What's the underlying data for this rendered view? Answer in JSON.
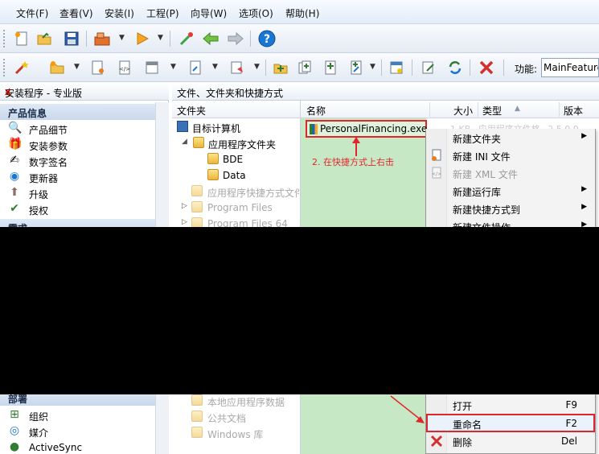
{
  "menu": [
    "文件(F)",
    "查看(V)",
    "安装(I)",
    "工程(P)",
    "向导(W)",
    "选项(O)",
    "帮助(H)"
  ],
  "toolbar": {
    "feature_label": "功能:",
    "feature_value": "MainFeature"
  },
  "left_panel": {
    "title": "安装程序 - 专业版",
    "close": "x",
    "groups": [
      {
        "header": "产品信息",
        "items": [
          "产品细节",
          "安装参数",
          "数字签名",
          "更新器",
          "升级",
          "授权"
        ]
      },
      {
        "header": "需求",
        "items": []
      },
      {
        "header": "部署",
        "items": [
          "组织",
          "媒介",
          "ActiveSync"
        ]
      }
    ]
  },
  "pane": {
    "title": "文件、文件夹和快捷方式",
    "folder_header": "文件夹",
    "tree": [
      {
        "label": "目标计算机",
        "dim": false
      },
      {
        "label": "应用程序文件夹",
        "dim": false
      },
      {
        "label": "BDE",
        "dim": false
      },
      {
        "label": "Data",
        "dim": false
      },
      {
        "label": "应用程序快捷方式文件夹",
        "dim": true
      },
      {
        "label": "Program Files",
        "dim": true
      },
      {
        "label": "Program Files 64",
        "dim": true
      },
      {
        "label": "本地应用程序数据",
        "dim": true
      },
      {
        "label": "公共文档",
        "dim": true
      },
      {
        "label": "Windows 库",
        "dim": true
      }
    ]
  },
  "list": {
    "columns": [
      "名称",
      "大小",
      "类型",
      "版本"
    ],
    "file": {
      "name": "PersonalFinancing.exe",
      "size": "1 KB",
      "type": "应用程序文件格",
      "version": "2.5.0.0"
    }
  },
  "annotation": "2. 在快捷方式上右击",
  "context_menu": [
    {
      "label": "新建文件夹",
      "submenu": true,
      "dim": false,
      "shortcut": ""
    },
    {
      "label": "新建 INI 文件",
      "submenu": false,
      "dim": false,
      "shortcut": ""
    },
    {
      "label": "新建 XML 文件",
      "submenu": false,
      "dim": true,
      "shortcut": ""
    },
    {
      "label": "新建运行库",
      "submenu": true,
      "dim": false,
      "shortcut": ""
    },
    {
      "label": "新建快捷方式到",
      "submenu": true,
      "dim": false,
      "shortcut": ""
    },
    {
      "label": "新建文件操作",
      "submenu": true,
      "dim": false,
      "shortcut": ""
    },
    {
      "label": "打开",
      "submenu": false,
      "dim": false,
      "shortcut": "F9"
    },
    {
      "label": "重命名",
      "submenu": false,
      "dim": false,
      "shortcut": "F2"
    },
    {
      "label": "删除",
      "submenu": false,
      "dim": false,
      "shortcut": "Del"
    }
  ],
  "colors": {
    "highlight_red": "#e0262d",
    "list_green": "#c7e8c4",
    "redaction": "#000000"
  }
}
